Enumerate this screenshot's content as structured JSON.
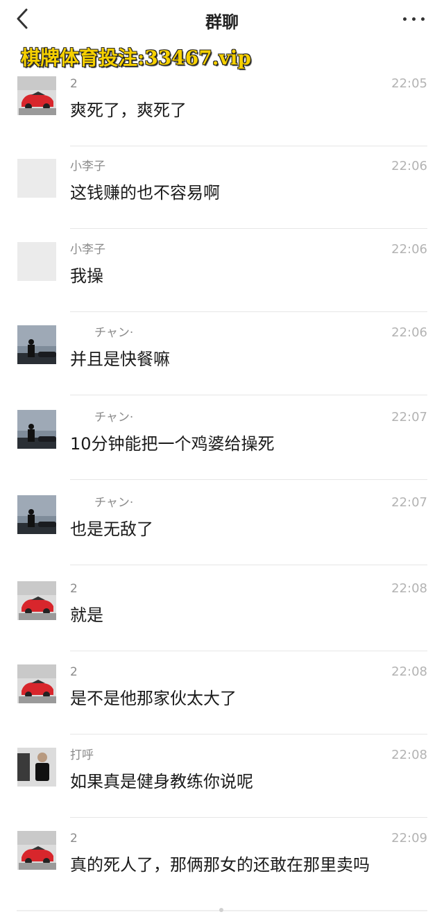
{
  "header": {
    "title": "群聊",
    "back_icon": "back-arrow-icon",
    "more_icon": "more-dots-icon"
  },
  "watermark": "棋牌体育投注:33467.vip",
  "messages": [
    {
      "sender": "2",
      "time": "22:05",
      "text": "爽死了，爽死了",
      "avatar": "red-car"
    },
    {
      "sender": "小李子",
      "time": "22:06",
      "text": "这钱赚的也不容易啊",
      "avatar": "blank"
    },
    {
      "sender": "小李子",
      "time": "22:06",
      "text": "我操",
      "avatar": "blank"
    },
    {
      "sender": "チャン·",
      "time": "22:06",
      "text": "并且是快餐嘛",
      "avatar": "night-man"
    },
    {
      "sender": "チャン·",
      "time": "22:07",
      "text": "10分钟能把一个鸡婆给操死",
      "avatar": "night-man"
    },
    {
      "sender": "チャン·",
      "time": "22:07",
      "text": "也是无敌了",
      "avatar": "night-man"
    },
    {
      "sender": "2",
      "time": "22:08",
      "text": "就是",
      "avatar": "red-car"
    },
    {
      "sender": "2",
      "time": "22:08",
      "text": "是不是他那家伙太大了",
      "avatar": "red-car"
    },
    {
      "sender": "打呼",
      "time": "22:08",
      "text": "如果真是健身教练你说呢",
      "avatar": "gym-man"
    },
    {
      "sender": "2",
      "time": "22:09",
      "text": "真的死人了，那俩那女的还敢在那里卖吗",
      "avatar": "red-car"
    }
  ]
}
